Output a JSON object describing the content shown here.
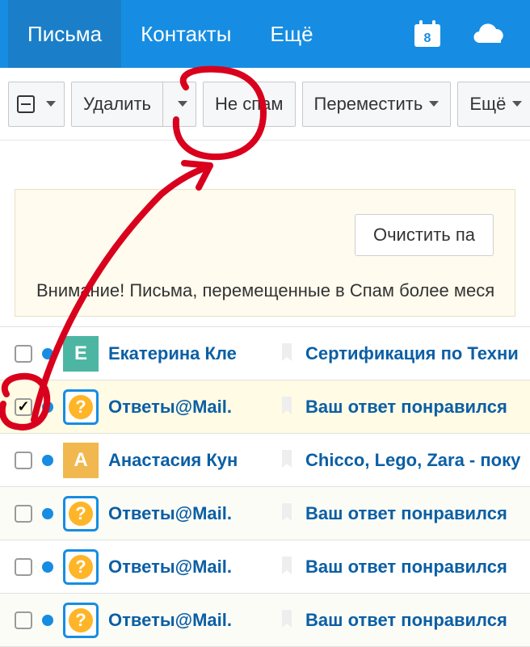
{
  "topnav": {
    "items": [
      {
        "label": "Письма",
        "active": true
      },
      {
        "label": "Контакты",
        "active": false
      },
      {
        "label": "Ещё",
        "active": false
      }
    ],
    "calendar_day": "8"
  },
  "toolbar": {
    "select_all_icon": "minus-box",
    "delete_label": "Удалить",
    "not_spam_label": "Не спам",
    "move_label": "Переместить",
    "more_label": "Ещё"
  },
  "notice": {
    "clear_button": "Очистить па",
    "text": "Внимание! Письма, перемещенные в Спам более месяца"
  },
  "messages": [
    {
      "checked": false,
      "unread": true,
      "avatar_type": "initial",
      "avatar_color": "e",
      "avatar_text": "Е",
      "sender": "Екатерина Кле",
      "subject": "Сертификация по Техни"
    },
    {
      "checked": true,
      "unread": true,
      "avatar_type": "q",
      "avatar_text": "?",
      "sender": "Ответы@Mail.",
      "subject": "Ваш ответ понравился"
    },
    {
      "checked": false,
      "unread": true,
      "avatar_type": "initial",
      "avatar_color": "a",
      "avatar_text": "А",
      "sender": "Анастасия Кун",
      "subject": "Chicco, Lego, Zara - поку"
    },
    {
      "checked": false,
      "unread": true,
      "avatar_type": "q",
      "avatar_text": "?",
      "sender": "Ответы@Mail.",
      "subject": "Ваш ответ понравился"
    },
    {
      "checked": false,
      "unread": true,
      "avatar_type": "q",
      "avatar_text": "?",
      "sender": "Ответы@Mail.",
      "subject": "Ваш ответ понравился"
    },
    {
      "checked": false,
      "unread": true,
      "avatar_type": "q",
      "avatar_text": "?",
      "sender": "Ответы@Mail.",
      "subject": "Ваш ответ понравился"
    }
  ]
}
